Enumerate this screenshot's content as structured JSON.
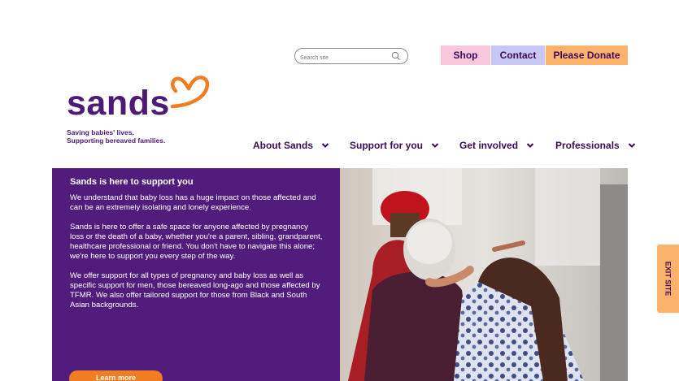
{
  "header": {
    "search": {
      "placeholder": "Search site"
    },
    "buttons": {
      "shop": "Shop",
      "contact": "Contact",
      "donate": "Please Donate"
    },
    "logo": {
      "word": "sands",
      "tagline_line1": "Saving babies' lives.",
      "tagline_line2": "Supporting bereaved families."
    },
    "nav": [
      "About Sands",
      "Support for you",
      "Get involved",
      "Professionals"
    ]
  },
  "hero": {
    "title": "Sands is here to support you",
    "paragraphs": [
      "We understand that baby loss has a huge impact on those affected and can be an extremely isolating and lonely experience.",
      "Sands is here to offer a safe space for anyone affected by pregnancy loss or the death of a baby, whether you're a parent, sibling, grandparent, healthcare professional or friend. You don't have to navigate this alone; we're here to support you every step of the way.",
      "We offer support for all types of pregnancy and baby loss as well as specific support for men, those bereaved long-ago and those affected by TFMR. We also offer tailored support for those from Black and South Asian backgrounds."
    ],
    "cta": "Learn more"
  },
  "exit_site": "EXIT SITE",
  "colors": {
    "brand_purple": "#521c7c",
    "orange": "#f07d22",
    "pink": "#f7c7dc",
    "lilac": "#c8c7f4",
    "donate_orange": "#fbb26b"
  },
  "icons": {
    "search": "search-icon",
    "chevron": "chevron-down-icon",
    "heart": "heart-logo-icon"
  }
}
